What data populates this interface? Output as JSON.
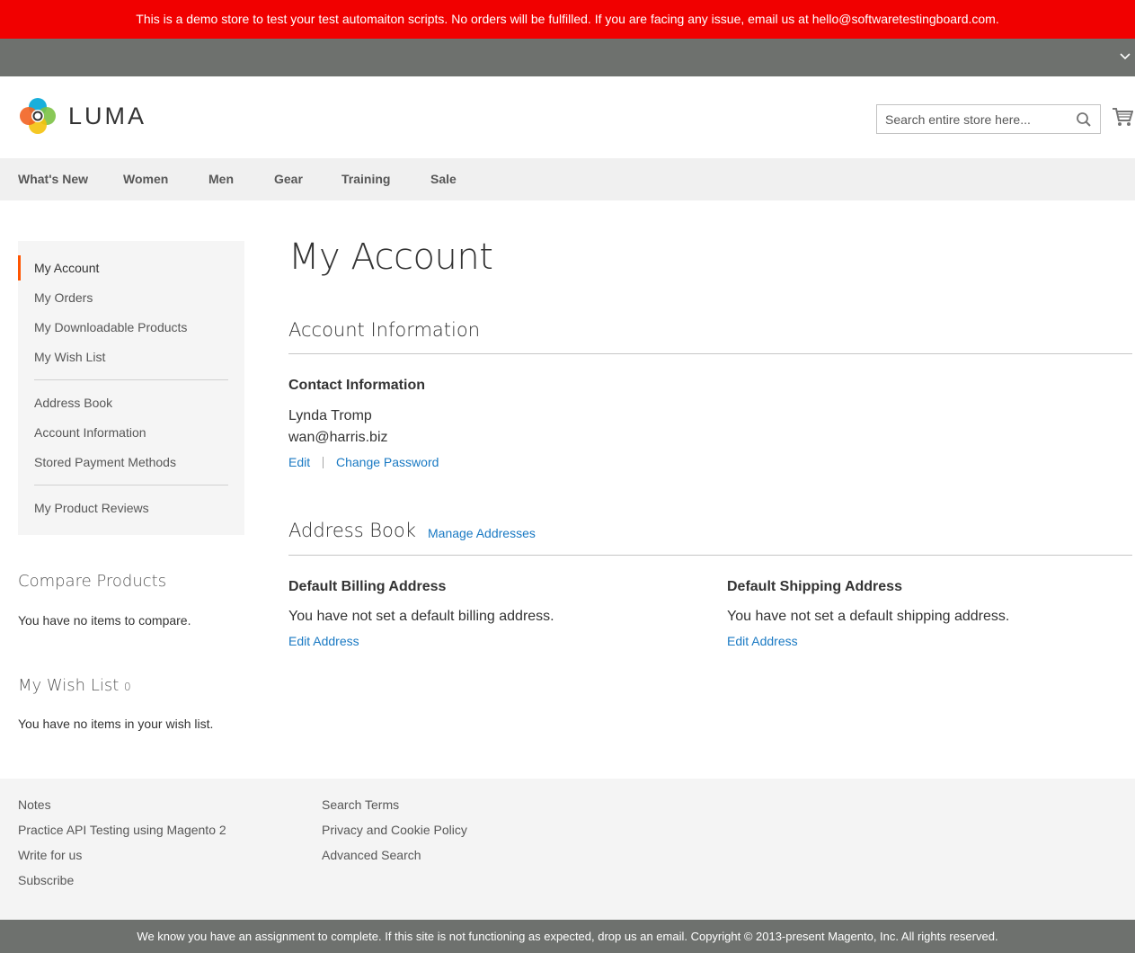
{
  "demo_banner": "This is a demo store to test your test automaiton scripts. No orders will be fulfilled. If you are facing any issue, email us at hello@softwaretestingboard.com.",
  "header": {
    "logo_text": "LUMA",
    "search_placeholder": "Search entire store here..."
  },
  "nav": {
    "items": [
      "What's New",
      "Women",
      "Men",
      "Gear",
      "Training",
      "Sale"
    ]
  },
  "sidebar": {
    "items": [
      "My Account",
      "My Orders",
      "My Downloadable Products",
      "My Wish List",
      "Address Book",
      "Account Information",
      "Stored Payment Methods",
      "My Product Reviews"
    ],
    "active": "My Account",
    "compare": {
      "title": "Compare Products",
      "empty_text": "You have no items to compare."
    },
    "wishlist": {
      "title": "My Wish List",
      "count": "0",
      "empty_text": "You have no items in your wish list."
    }
  },
  "main": {
    "page_title": "My Account",
    "account_info": {
      "title": "Account Information",
      "contact_title": "Contact Information",
      "name": "Lynda Tromp",
      "email": "wan@harris.biz",
      "edit_link": "Edit",
      "change_password_link": "Change Password"
    },
    "address_book": {
      "title": "Address Book",
      "manage_link": "Manage Addresses",
      "billing": {
        "title": "Default Billing Address",
        "text": "You have not set a default billing address.",
        "link": "Edit Address"
      },
      "shipping": {
        "title": "Default Shipping Address",
        "text": "You have not set a default shipping address.",
        "link": "Edit Address"
      }
    }
  },
  "footer": {
    "col1": [
      "Notes",
      "Practice API Testing using Magento 2",
      "Write for us",
      "Subscribe"
    ],
    "col2": [
      "Search Terms",
      "Privacy and Cookie Policy",
      "Advanced Search"
    ],
    "copyright": "We know you have an assignment to complete. If this site is not functioning as expected, drop us an email. Copyright © 2013-present Magento, Inc. All rights reserved."
  },
  "colors": {
    "demo_banner": "#f10000",
    "accent_bar": "#ff5501",
    "link": "#1979c3",
    "panel": "#6e716e"
  }
}
